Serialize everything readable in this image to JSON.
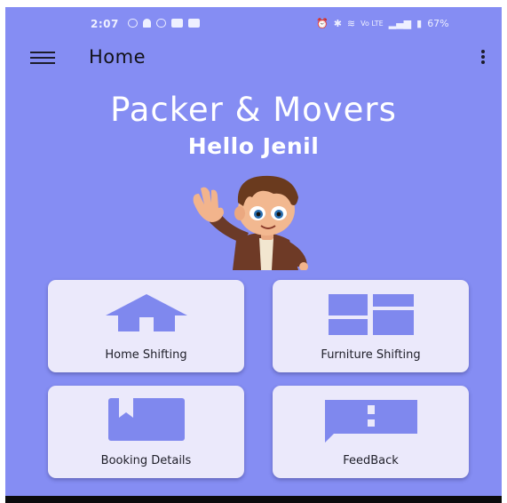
{
  "status_bar": {
    "time": "2:07",
    "right_text": "Vo LTE",
    "battery": "67%"
  },
  "app_bar": {
    "title": "Home"
  },
  "main": {
    "headline": "Packer & Movers",
    "greeting": "Hello Jenil"
  },
  "cards": [
    {
      "label": "Home Shifting",
      "icon": "house-icon"
    },
    {
      "label": "Furniture Shifting",
      "icon": "dashboard-grid-icon"
    },
    {
      "label": "Booking Details",
      "icon": "bookmark-book-icon"
    },
    {
      "label": "FeedBack",
      "icon": "feedback-chat-icon"
    }
  ],
  "colors": {
    "background": "#858df3",
    "card": "#ebe9fb",
    "icon": "#7f88ee",
    "text_dark": "#1e1e28",
    "text_light": "#ffffff"
  }
}
